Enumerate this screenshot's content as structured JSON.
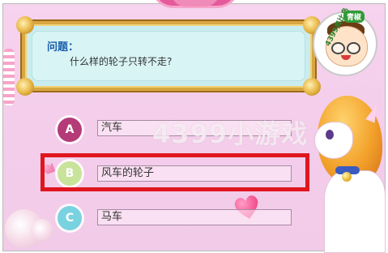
{
  "watermark": "4399小游戏",
  "badge": {
    "ring_text": "4399奥比岛",
    "tag": "青椒"
  },
  "question": {
    "title": "问题：",
    "text": "什么样的轮子只转不走?"
  },
  "options": [
    {
      "letter": "A",
      "text": "汽车",
      "color": "#b43b78"
    },
    {
      "letter": "B",
      "text": "风车的轮子",
      "color": "#c8e39a",
      "selected": true
    },
    {
      "letter": "C",
      "text": "马车",
      "color": "#79d2df"
    }
  ],
  "colors": {
    "highlight": "#e0161e",
    "panel": "#d8f4f5",
    "frame_gold": "#d8a742",
    "question_title": "#1b5fae"
  }
}
